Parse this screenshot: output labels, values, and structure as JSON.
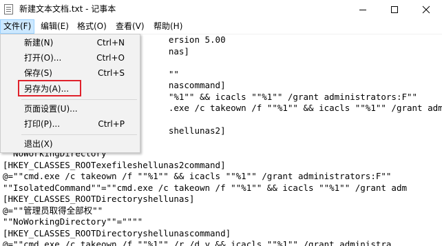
{
  "window": {
    "title": "新建文本文档.txt - 记事本",
    "icon": "notepad-icon",
    "controls": [
      "minimize-icon",
      "maximize-icon",
      "close-icon"
    ]
  },
  "menubar": {
    "items": [
      "文件(F)",
      "编辑(E)",
      "格式(O)",
      "查看(V)",
      "帮助(H)"
    ],
    "active_index": 0
  },
  "file_menu": {
    "items": [
      {
        "label": "新建(N)",
        "shortcut": "Ctrl+N"
      },
      {
        "label": "打开(O)...",
        "shortcut": "Ctrl+O"
      },
      {
        "label": "保存(S)",
        "shortcut": "Ctrl+S"
      },
      {
        "label": "另存为(A)...",
        "shortcut": ""
      },
      {
        "label": "页面设置(U)...",
        "shortcut": ""
      },
      {
        "label": "打印(P)...",
        "shortcut": "Ctrl+P"
      },
      {
        "label": "退出(X)",
        "shortcut": ""
      }
    ],
    "highlighted_item": "另存为(A)...",
    "highlight_color": "#e0212b"
  },
  "editor": {
    "lines": [
      "                                ersion 5.00",
      "                                nas]",
      "",
      "                                \"\"",
      "                                nascommand]",
      "                                \"%1\"\" && icacls \"\"%1\"\" /grant administrators:F\"\"",
      "                                .exe /c takeown /f \"\"%1\"\" && icacls \"\"%1\"\" /grant adm",
      "",
      "                                shellunas2]",
      "",
      "  NoWorkingDirectory",
      "[HKEY_CLASSES_ROOTexefileshellunas2command]",
      "@=\"\"cmd.exe /c takeown /f \"\"%1\"\" && icacls \"\"%1\"\" /grant administrators:F\"\"",
      "\"\"IsolatedCommand\"\"=\"\"cmd.exe /c takeown /f \"\"%1\"\" && icacls \"\"%1\"\" /grant adm",
      "[HKEY_CLASSES_ROOTDirectoryshellunas]",
      "@=\"\"管理员取得全部权\"\"",
      "\"\"NoWorkingDirectory\"\"=\"\"\"\"",
      "[HKEY_CLASSES_ROOTDirectoryshellunascommand]",
      "@=\"\"cmd.exe /c takeown /f \"\"%1\"\" /r /d y && icacls \"\"%1\"\" /grant administra"
    ]
  }
}
